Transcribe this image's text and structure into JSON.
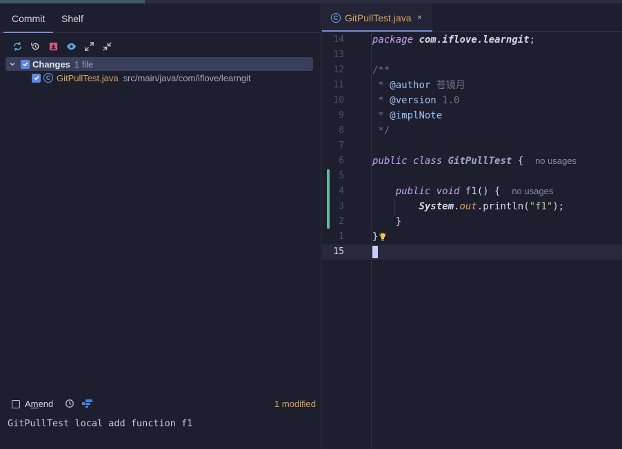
{
  "left_panel": {
    "tabs": [
      {
        "label": "Commit"
      },
      {
        "label": "Shelf"
      }
    ],
    "toolbar": [
      "refresh-icon",
      "rollback-icon",
      "shelve-icon",
      "preview-eye-icon",
      "expand-all-icon",
      "collapse-all-icon"
    ],
    "changes": {
      "label": "Changes",
      "count": "1 file",
      "files": [
        {
          "name": "GitPullTest.java",
          "path": "src/main/java/com/iflove/learngit"
        }
      ]
    },
    "amend_label": "Amend",
    "amend_underlined_char": "m",
    "modified_status": "1 modified",
    "commit_message": "GitPullTest local add function f1"
  },
  "editor": {
    "tab": {
      "name": "GitPullTest.java",
      "close": "×"
    },
    "lines": [
      {
        "num": "14"
      },
      {
        "num": "13"
      },
      {
        "num": "12"
      },
      {
        "num": "11"
      },
      {
        "num": "10"
      },
      {
        "num": "9"
      },
      {
        "num": "8"
      },
      {
        "num": "7"
      },
      {
        "num": "6"
      },
      {
        "num": "5"
      },
      {
        "num": "4"
      },
      {
        "num": "3"
      },
      {
        "num": "2"
      },
      {
        "num": "1"
      },
      {
        "num": "15"
      }
    ],
    "code": {
      "package_kw": "package",
      "package_name": "com.iflove.learngit",
      "semicolon": ";",
      "doc_open": "/**",
      "doc_star": " * ",
      "author_tag": "@author",
      "author_value": "苍镜月",
      "version_tag": "@version",
      "version_value": "1.0",
      "impl_tag": "@implNote",
      "doc_close": " */",
      "public_kw": "public",
      "class_kw": "class",
      "class_name": "GitPullTest",
      "open_brace": "{",
      "no_usages": "no usages",
      "void_kw": "void",
      "method_name": "f1",
      "parens": "()",
      "system": "System",
      "dot": ".",
      "out": "out",
      "println": "println",
      "open_paren": "(",
      "string": "\"f1\"",
      "close_paren_semi": ");",
      "close_brace": "}"
    }
  },
  "colors": {
    "accent": "#7a8bd9",
    "modified": "#d9a55a",
    "change_marker": "#5fb9a0"
  }
}
